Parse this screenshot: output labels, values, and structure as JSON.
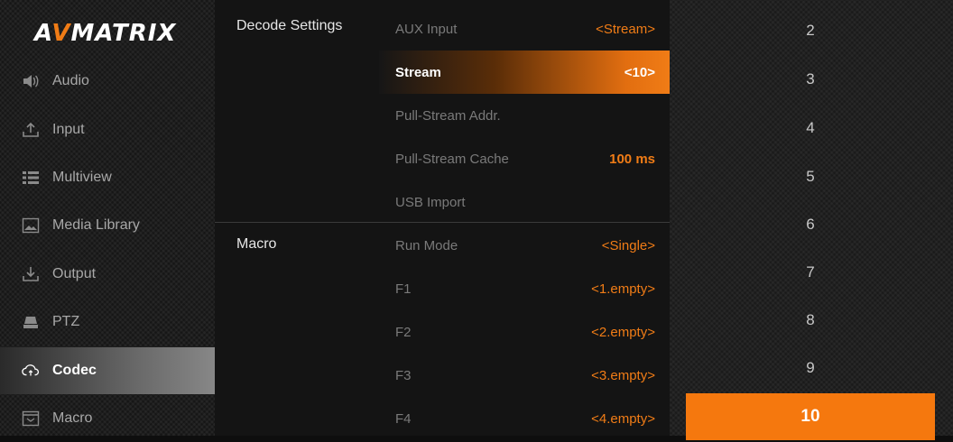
{
  "brand": {
    "logo_pre": "A",
    "logo_v": "V",
    "logo_post": "MATRIX",
    "accent": "#f07c16"
  },
  "sidebar": {
    "items": [
      {
        "label": "Audio",
        "icon": "speaker-icon"
      },
      {
        "label": "Input",
        "icon": "upload-icon"
      },
      {
        "label": "Multiview",
        "icon": "grid-list-icon"
      },
      {
        "label": "Media Library",
        "icon": "image-icon"
      },
      {
        "label": "Output",
        "icon": "download-icon"
      },
      {
        "label": "PTZ",
        "icon": "ptz-camera-icon"
      },
      {
        "label": "Codec",
        "icon": "cloud-sync-icon",
        "active": true
      },
      {
        "label": "Macro",
        "icon": "macro-window-icon"
      }
    ]
  },
  "panel": {
    "decode": {
      "label": "Decode Settings",
      "rows": [
        {
          "label": "AUX Input",
          "value": "<Stream>"
        },
        {
          "label": "Stream",
          "value": "<10>",
          "selected": true
        },
        {
          "label": "Pull-Stream Addr.",
          "value": ""
        },
        {
          "label": "Pull-Stream Cache",
          "value": "100 ms"
        },
        {
          "label": "USB Import",
          "value": ""
        }
      ]
    },
    "macro": {
      "label": "Macro",
      "rows": [
        {
          "label": "Run Mode",
          "value": "<Single>"
        },
        {
          "label": "F1",
          "value": "<1.empty>"
        },
        {
          "label": "F2",
          "value": "<2.empty>"
        },
        {
          "label": "F3",
          "value": "<3.empty>"
        },
        {
          "label": "F4",
          "value": "<4.empty>"
        }
      ]
    }
  },
  "picker": {
    "options": [
      "2",
      "3",
      "4",
      "5",
      "6",
      "7",
      "8",
      "9",
      "10"
    ],
    "selected": "10"
  }
}
